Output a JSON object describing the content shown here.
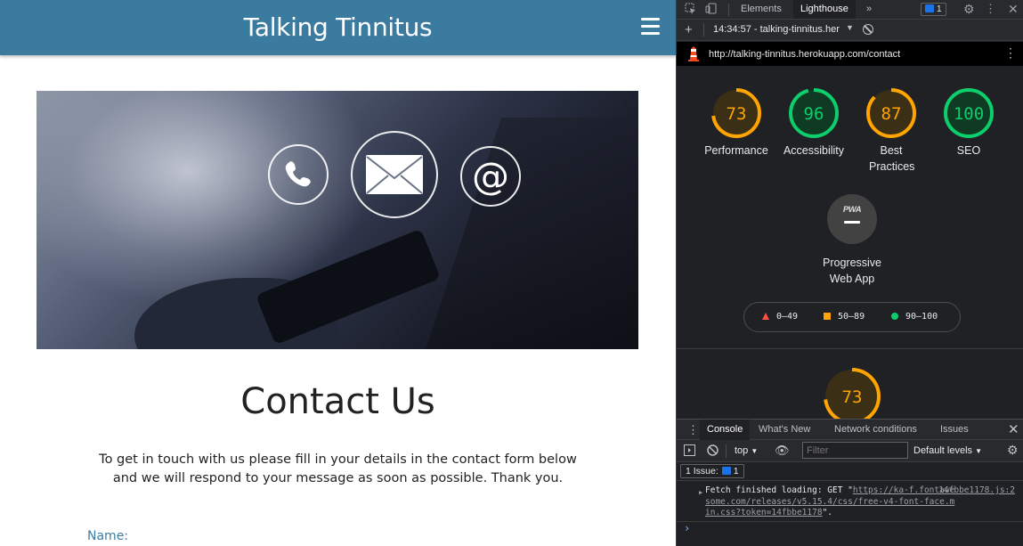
{
  "site": {
    "title": "Talking Tinnitus",
    "contact_heading": "Contact Us",
    "contact_text": "To get in touch with us please fill in your details in the contact form below and we will respond to your message as soon as possible. Thank you.",
    "name_label": "Name:",
    "brand_color": "#3c7ba0",
    "hero_icons": [
      "phone-icon",
      "envelope-icon",
      "at-sign-icon"
    ]
  },
  "devtools": {
    "tabs": [
      {
        "label": "Elements"
      },
      {
        "label": "Lighthouse"
      }
    ],
    "more_tabs": "»",
    "issues_count": "1",
    "report_selector": "14:34:57 - talking-tinnitus.her",
    "report_url": "http://talking-tinnitus.herokuapp.com/contact",
    "scores": [
      {
        "label": "Performance",
        "value": 73,
        "status_color": "#ffa400"
      },
      {
        "label": "Accessibility",
        "value": 96,
        "status_color": "#0cce6b"
      },
      {
        "label": "Best Practices",
        "value": 87,
        "status_color": "#ffa400"
      },
      {
        "label": "SEO",
        "value": 100,
        "status_color": "#0cce6b"
      }
    ],
    "pwa": {
      "badge": "PWA",
      "label": "Progressive Web App"
    },
    "legend": [
      {
        "range": "0–49",
        "color": "#ff4e42"
      },
      {
        "range": "50–89",
        "color": "#ffa400"
      },
      {
        "range": "90–100",
        "color": "#0cce6b"
      }
    ],
    "performance_detail_score": 73,
    "drawer_tabs": [
      {
        "label": "Console"
      },
      {
        "label": "What's New"
      },
      {
        "label": "Network conditions"
      },
      {
        "label": "Issues"
      }
    ],
    "console": {
      "context": "top",
      "filter_placeholder": "Filter",
      "levels": "Default levels",
      "issues_label": "1 Issue:",
      "issues_count": "1",
      "log_prefix": "Fetch finished loading: GET \"",
      "log_url": "https://ka-f.fontawesome.com/releases/v5.15.4/css/free-v4-font-face.min.css?token=14fbbe1178",
      "log_suffix": "\".",
      "log_source": "14fbbe1178.js:2"
    }
  }
}
